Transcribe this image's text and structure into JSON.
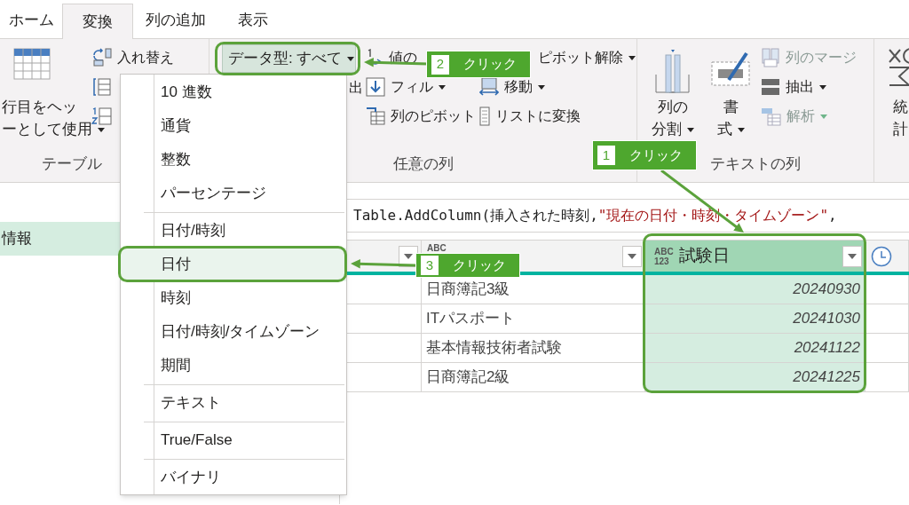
{
  "tabs": [
    {
      "label": "ホーム",
      "selected": false
    },
    {
      "label": "変換",
      "selected": true
    },
    {
      "label": "列の追加",
      "selected": false
    },
    {
      "label": "表示",
      "selected": false
    }
  ],
  "ribbon": {
    "groups": [
      {
        "label": "テーブル",
        "columns": [
          [
            {
              "kind": "large",
              "lines": [
                "行目をヘッ",
                "ーとして使用"
              ],
              "dropdown": true
            }
          ],
          [
            {
              "kind": "small",
              "label": "入れ替え",
              "dropdown": false
            },
            {
              "kind": "icon-only"
            },
            {
              "kind": "icon-only"
            }
          ]
        ]
      },
      {
        "label": "任意の列",
        "columns": [
          [
            {
              "kind": "type-button",
              "label": "データ型: すべて",
              "dropdown": true
            },
            {
              "kind": "clipped",
              "label": "出"
            }
          ],
          [
            {
              "kind": "small",
              "label": "値の",
              "dropdown": false
            },
            {
              "kind": "small",
              "label": "フィル",
              "dropdown": true
            },
            {
              "kind": "small",
              "label": "列のピボット",
              "dropdown": false
            }
          ],
          [
            {
              "kind": "small",
              "label": "ピボット解除",
              "dropdown": true
            },
            {
              "kind": "small",
              "label": "移動",
              "dropdown": true
            },
            {
              "kind": "small",
              "label": "リストに変換",
              "dropdown": false
            }
          ]
        ]
      },
      {
        "label": "テキストの列",
        "columns": [
          [
            {
              "kind": "large",
              "lines": [
                "列の",
                "分割"
              ],
              "dropdown": true
            }
          ],
          [
            {
              "kind": "large",
              "lines": [
                "書",
                "式"
              ],
              "dropdown": true
            }
          ],
          [
            {
              "kind": "small",
              "label": "列のマージ",
              "dropdown": false,
              "disabled": true
            },
            {
              "kind": "small",
              "label": "抽出",
              "dropdown": true,
              "disabled": false
            },
            {
              "kind": "small",
              "label": "解析",
              "dropdown": true,
              "disabled": true
            }
          ]
        ]
      },
      {
        "columns": [
          [
            {
              "kind": "large",
              "lines": [
                "統",
                "計"
              ],
              "dropdown": false
            }
          ]
        ]
      }
    ]
  },
  "queries": [
    {
      "label": "情報",
      "selected": true
    }
  ],
  "formula": [
    {
      "kind": "code",
      "text": "Table.AddColumn(挿入された時刻, "
    },
    {
      "kind": "string",
      "text": "\"現在の日付・時刻・タイムゾーン\""
    },
    {
      "kind": "code",
      "text": ","
    }
  ],
  "table": {
    "columns": [
      {
        "selected": false
      },
      {
        "type_badge": [
          "ABC"
        ],
        "selected": false
      },
      {
        "title": "試験日",
        "type_badge": [
          "ABC",
          "123"
        ],
        "selected": true
      },
      {
        "kind": "time",
        "selected": false
      }
    ],
    "rows": [
      [
        "",
        "日商簿記3級",
        "20240930"
      ],
      [
        "",
        "ITパスポート",
        "20241030"
      ],
      [
        "",
        "基本情報技術者試験",
        "20241122"
      ],
      [
        "",
        "日商簿記2級",
        "20241225"
      ]
    ]
  },
  "type_menu": {
    "groups": [
      [
        {
          "label": "10 進数",
          "selected": false
        },
        {
          "label": "通貨",
          "selected": false
        },
        {
          "label": "整数",
          "selected": false
        },
        {
          "label": "パーセンテージ",
          "selected": false
        }
      ],
      [
        {
          "label": "日付/時刻",
          "selected": false
        },
        {
          "label": "日付",
          "selected": true
        },
        {
          "label": "時刻",
          "selected": false
        },
        {
          "label": "日付/時刻/タイムゾーン",
          "selected": false
        },
        {
          "label": "期間",
          "selected": false
        }
      ],
      [
        {
          "label": "テキスト",
          "selected": false
        }
      ],
      [
        {
          "label": "True/False",
          "selected": false
        }
      ],
      [
        {
          "label": "バイナリ",
          "selected": false
        }
      ]
    ]
  },
  "callouts": [
    {
      "number": "1",
      "text": "クリック"
    },
    {
      "number": "2",
      "text": "クリック"
    },
    {
      "number": "3",
      "text": "クリック"
    }
  ]
}
